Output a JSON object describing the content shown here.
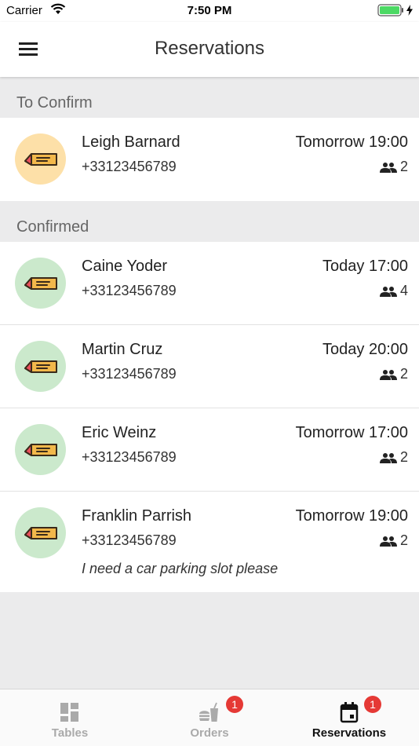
{
  "status_bar": {
    "carrier": "Carrier",
    "time": "7:50 PM"
  },
  "header": {
    "title": "Reservations",
    "menu_icon": "hamburger-menu-icon"
  },
  "sections": {
    "to_confirm": {
      "title": "To Confirm",
      "items": [
        {
          "name": "Leigh Barnard",
          "phone": "+33123456789",
          "time": "Tomorrow 19:00",
          "guests": "2"
        }
      ]
    },
    "confirmed": {
      "title": "Confirmed",
      "items": [
        {
          "name": "Caine Yoder",
          "phone": "+33123456789",
          "time": "Today 17:00",
          "guests": "4"
        },
        {
          "name": "Martin Cruz",
          "phone": "+33123456789",
          "time": "Today 20:00",
          "guests": "2"
        },
        {
          "name": "Eric Weinz",
          "phone": "+33123456789",
          "time": "Tomorrow 17:00",
          "guests": "2"
        },
        {
          "name": "Franklin Parrish",
          "phone": "+33123456789",
          "time": "Tomorrow 19:00",
          "guests": "2",
          "note": "I need a car parking slot please"
        }
      ]
    }
  },
  "tabs": [
    {
      "label": "Tables",
      "icon": "tables-icon",
      "active": false
    },
    {
      "label": "Orders",
      "icon": "orders-icon",
      "badge": "1",
      "active": false
    },
    {
      "label": "Reservations",
      "icon": "calendar-icon",
      "badge": "1",
      "active": true
    }
  ],
  "colors": {
    "pending_avatar": "#fde0a8",
    "confirmed_avatar": "#cbe9cc",
    "badge": "#e53935",
    "battery": "#4cd964"
  }
}
